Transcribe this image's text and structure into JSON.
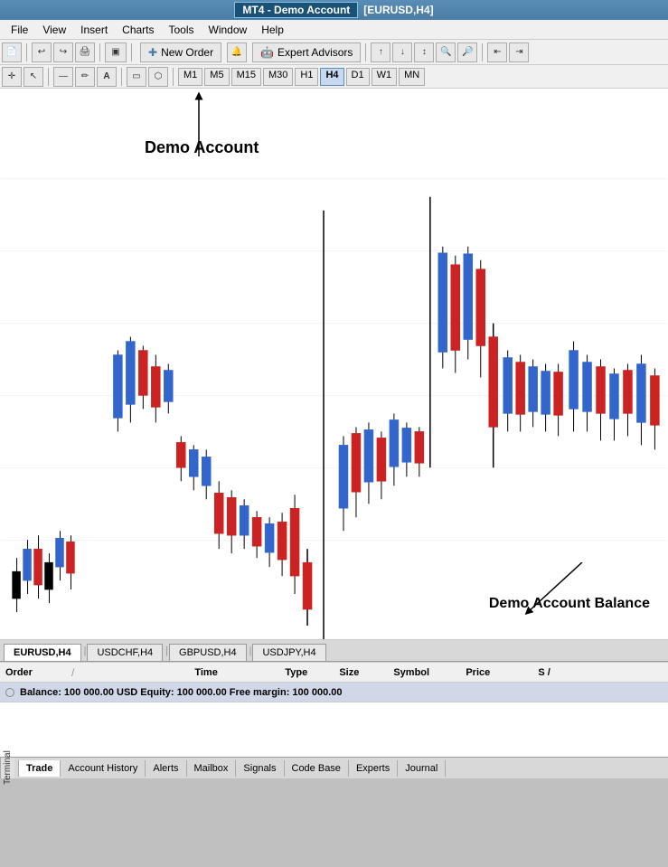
{
  "titleBar": {
    "text": "MT4 - Demo Account",
    "symbol": "[EURUSD,H4]"
  },
  "menuBar": {
    "items": [
      "File",
      "View",
      "Insert",
      "Charts",
      "Tools",
      "Window",
      "Help"
    ]
  },
  "toolbar1": {
    "newOrderLabel": "New Order",
    "expertAdvisorsLabel": "Expert Advisors"
  },
  "toolbar2": {
    "timeframes": [
      "M1",
      "M5",
      "M15",
      "M30",
      "H1",
      "H4",
      "D1",
      "W1",
      "MN"
    ],
    "active": "H4"
  },
  "chartAnnotations": {
    "demoAccountLabel": "Demo Account",
    "demoAccountBalanceLabel": "Demo Account Balance"
  },
  "chartTabs": {
    "tabs": [
      "EURUSD,H4",
      "USDCHF,H4",
      "GBPUSD,H4",
      "USDJPY,H4"
    ],
    "active": "EURUSD,H4"
  },
  "terminal": {
    "label": "Terminal",
    "columns": [
      "Order",
      "/",
      "Time",
      "Type",
      "Size",
      "Symbol",
      "Price",
      "S /"
    ],
    "balanceRow": "Balance: 100 000.00 USD  Equity: 100 000.00  Free margin: 100 000.00"
  },
  "terminalTabs": {
    "tabs": [
      "Trade",
      "Account History",
      "Alerts",
      "Mailbox",
      "Signals",
      "Code Base",
      "Experts",
      "Journal"
    ],
    "active": "Trade"
  }
}
